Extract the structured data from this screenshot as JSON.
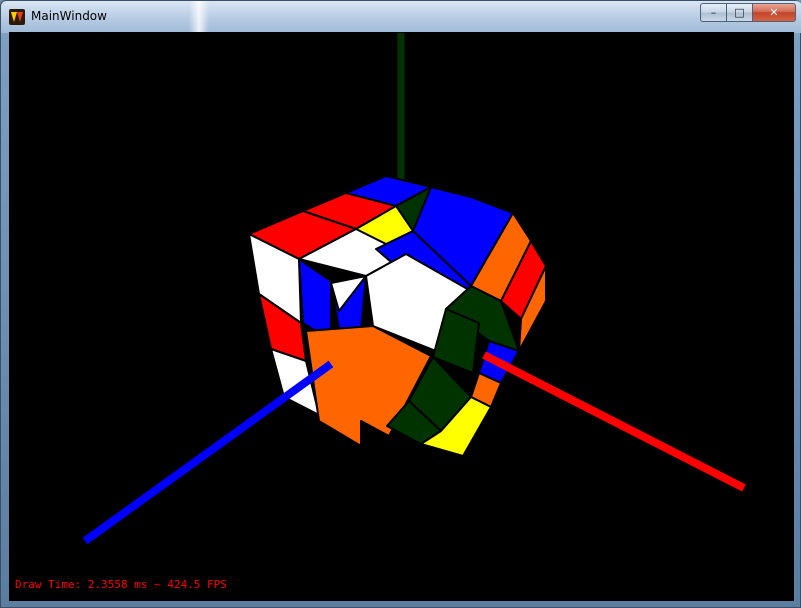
{
  "window": {
    "title": "MainWindow",
    "controls": {
      "minimize": "–",
      "maximize": "□",
      "close": "✕"
    }
  },
  "viewport": {
    "status_text": "Draw Time: 2.3558 ms ~ 424.5 FPS",
    "status_color": "#ff0000",
    "background": "#000000"
  },
  "scene": {
    "axes": {
      "x_color": "#ff0000",
      "y_color": "#003300",
      "z_color": "#0000ff"
    },
    "cube_colors": [
      "#ffffff",
      "#ff0000",
      "#0000ff",
      "#ff6600",
      "#ffff00",
      "#003300"
    ]
  }
}
